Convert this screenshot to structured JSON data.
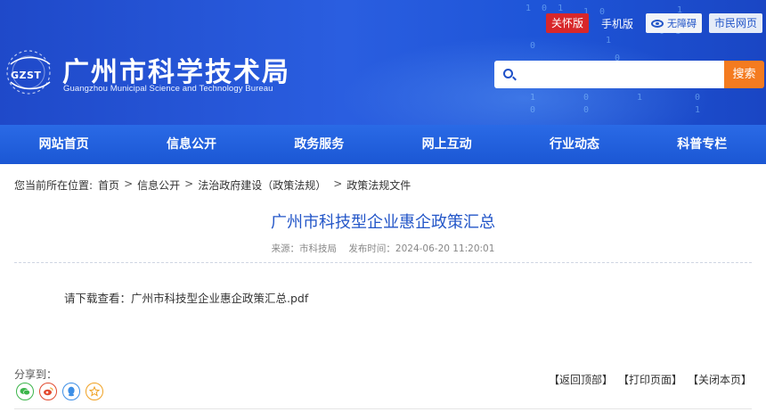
{
  "header": {
    "logo_text": "GZST",
    "title": "广州市科学技术局",
    "subtitle": "Guangzhou Municipal Science and Technology Bureau",
    "top_links": {
      "care_mode": "关怀版",
      "mobile": "手机版",
      "accessibility": "无障碍",
      "citizen": "市民网页"
    },
    "search": {
      "placeholder": "",
      "button": "搜索"
    }
  },
  "nav": {
    "items": [
      "网站首页",
      "信息公开",
      "政务服务",
      "网上互动",
      "行业动态",
      "科普专栏"
    ]
  },
  "breadcrumb": {
    "prefix": "您当前所在位置:",
    "items": [
      "首页",
      "信息公开",
      "法治政府建设（政策法规）",
      "政策法规文件"
    ]
  },
  "article": {
    "title": "广州市科技型企业惠企政策汇总",
    "source": "来源：市科技局",
    "publish_time": "发布时间：2024-06-20 11:20:01",
    "download_prefix": "请下载查看：",
    "download_file": "广州市科技型企业惠企政策汇总.pdf"
  },
  "share": {
    "label": "分享到：",
    "icons": [
      "wechat-icon",
      "weibo-icon",
      "qq-icon",
      "qzone-icon"
    ]
  },
  "page_actions": {
    "back_to_top": "【返回顶部】",
    "print": "【打印页面】",
    "close": "【关闭本页】"
  },
  "colors": {
    "header_blue": "#2356c8",
    "nav_blue": "#1b57d4",
    "care_red": "#d8272a",
    "search_orange": "#f47b20",
    "title_blue": "#2356c8"
  }
}
